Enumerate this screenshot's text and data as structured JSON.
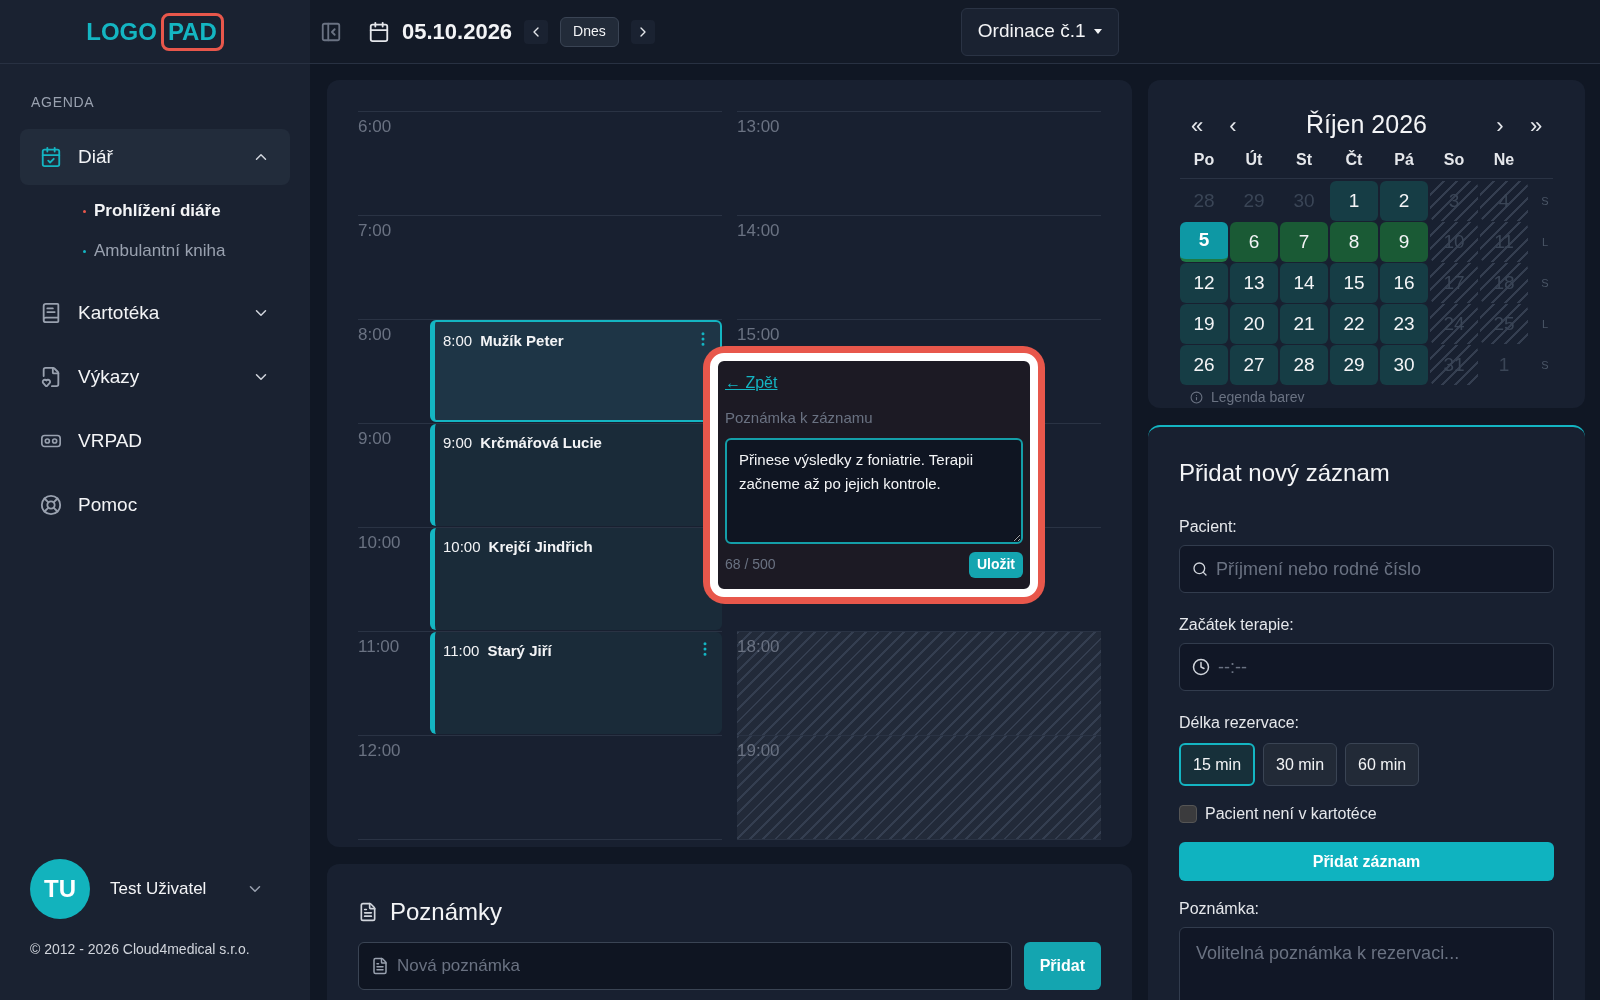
{
  "logo": {
    "first": "LOGO",
    "second": "PAD"
  },
  "sidebar": {
    "section": "AGENDA",
    "items": [
      {
        "label": "Diář",
        "selected": true,
        "expanded": true,
        "children": [
          {
            "label": "Prohlížení diáře",
            "selected": true
          },
          {
            "label": "Ambulantní kniha",
            "selected": false
          }
        ]
      },
      {
        "label": "Kartotéka",
        "selected": false,
        "expanded": false
      },
      {
        "label": "Výkazy",
        "selected": false,
        "expanded": false
      },
      {
        "label": "VRPAD",
        "selected": false
      },
      {
        "label": "Pomoc",
        "selected": false
      }
    ],
    "user": {
      "initials": "TU",
      "name": "Test Uživatel"
    },
    "copyright": "© 2012 - 2026 Cloud4medical s.r.o."
  },
  "header": {
    "date": "05.10.2026",
    "today_button": "Dnes",
    "office": "Ordinace č.1"
  },
  "schedule": {
    "columns": [
      [
        {
          "label": "6:00"
        },
        {
          "label": "7:00"
        },
        {
          "label": "8:00",
          "event": {
            "time": "8:00",
            "name": "Mužík Peter",
            "selected": true,
            "menu": true
          }
        },
        {
          "label": "9:00",
          "event": {
            "time": "9:00",
            "name": "Krčmářová Lucie",
            "selected": false
          }
        },
        {
          "label": "10:00",
          "event": {
            "time": "10:00",
            "name": "Krejčí Jindřich",
            "selected": false
          }
        },
        {
          "label": "11:00",
          "event": {
            "time": "11:00",
            "name": "Starý Jiří",
            "selected": false,
            "menu": true
          }
        },
        {
          "label": "12:00"
        }
      ],
      [
        {
          "label": "13:00",
          "blocked": false
        },
        {
          "label": "14:00",
          "blocked": false
        },
        {
          "label": "15:00",
          "blocked": false
        },
        {
          "blocked": false
        },
        {
          "blocked": false
        },
        {
          "label": "18:00",
          "blocked": true
        },
        {
          "label": "19:00",
          "blocked": true
        }
      ]
    ]
  },
  "note_popup": {
    "back_link": "← Zpět",
    "label": "Poznámka k záznamu",
    "value": "Přinese výsledky z foniatrie. Terapii začneme až po jejich kontrole.",
    "counter": "68 / 500",
    "save_button": "Uložit"
  },
  "notes": {
    "title": "Poznámky",
    "placeholder": "Nová poznámka",
    "add_button": "Přidat"
  },
  "mini_calendar": {
    "nav": {
      "prev_year": "«",
      "prev_month": "‹",
      "title": "Říjen 2026",
      "next_month": "›",
      "next_year": "»"
    },
    "weekdays": [
      "Po",
      "Út",
      "St",
      "Čt",
      "Pá",
      "So",
      "Ne"
    ],
    "weeks": [
      {
        "marker": "S",
        "days": [
          {
            "day": "28",
            "kind": "outside",
            "selected": false
          },
          {
            "day": "29",
            "kind": "outside",
            "selected": false
          },
          {
            "day": "30",
            "kind": "outside",
            "selected": false
          },
          {
            "day": "1",
            "kind": "workday",
            "selected": false
          },
          {
            "day": "2",
            "kind": "workday",
            "selected": false
          },
          {
            "day": "3",
            "kind": "weekend",
            "selected": false
          },
          {
            "day": "4",
            "kind": "weekend",
            "selected": false
          }
        ]
      },
      {
        "marker": "L",
        "days": [
          {
            "day": "5",
            "kind": "booked",
            "selected": true
          },
          {
            "day": "6",
            "kind": "booked",
            "selected": false
          },
          {
            "day": "7",
            "kind": "booked",
            "selected": false
          },
          {
            "day": "8",
            "kind": "booked",
            "selected": false
          },
          {
            "day": "9",
            "kind": "booked",
            "selected": false
          },
          {
            "day": "10",
            "kind": "weekend",
            "selected": false
          },
          {
            "day": "11",
            "kind": "weekend",
            "selected": false
          }
        ]
      },
      {
        "marker": "S",
        "days": [
          {
            "day": "12",
            "kind": "workday",
            "selected": false
          },
          {
            "day": "13",
            "kind": "workday",
            "selected": false
          },
          {
            "day": "14",
            "kind": "workday",
            "selected": false
          },
          {
            "day": "15",
            "kind": "workday",
            "selected": false
          },
          {
            "day": "16",
            "kind": "workday",
            "selected": false
          },
          {
            "day": "17",
            "kind": "weekend",
            "selected": false
          },
          {
            "day": "18",
            "kind": "weekend",
            "selected": false
          }
        ]
      },
      {
        "marker": "L",
        "days": [
          {
            "day": "19",
            "kind": "workday",
            "selected": false
          },
          {
            "day": "20",
            "kind": "workday",
            "selected": false
          },
          {
            "day": "21",
            "kind": "workday",
            "selected": false
          },
          {
            "day": "22",
            "kind": "workday",
            "selected": false
          },
          {
            "day": "23",
            "kind": "workday",
            "selected": false
          },
          {
            "day": "24",
            "kind": "weekend",
            "selected": false
          },
          {
            "day": "25",
            "kind": "weekend",
            "selected": false
          }
        ]
      },
      {
        "marker": "S",
        "days": [
          {
            "day": "26",
            "kind": "workday",
            "selected": false
          },
          {
            "day": "27",
            "kind": "workday",
            "selected": false
          },
          {
            "day": "28",
            "kind": "workday",
            "selected": false
          },
          {
            "day": "29",
            "kind": "workday",
            "selected": false
          },
          {
            "day": "30",
            "kind": "workday",
            "selected": false
          },
          {
            "day": "31",
            "kind": "weekend",
            "selected": false
          },
          {
            "day": "1",
            "kind": "outside",
            "selected": false
          }
        ]
      }
    ],
    "legend": "Legenda barev"
  },
  "new_record": {
    "title": "Přidat nový záznam",
    "patient_label": "Pacient:",
    "patient_placeholder": "Příjmení nebo rodné číslo",
    "start_label": "Začátek terapie:",
    "start_placeholder": "--:--",
    "length_label": "Délka rezervace:",
    "lengths": [
      {
        "label": "15 min",
        "selected": true
      },
      {
        "label": "30 min",
        "selected": false
      },
      {
        "label": "60 min",
        "selected": false
      }
    ],
    "not_in_registry": {
      "label": "Pacient není v kartotéce",
      "checked": false
    },
    "submit_button": "Přidat záznam",
    "note_label": "Poznámka:",
    "note_placeholder": "Volitelná poznámka k rezervaci..."
  }
}
